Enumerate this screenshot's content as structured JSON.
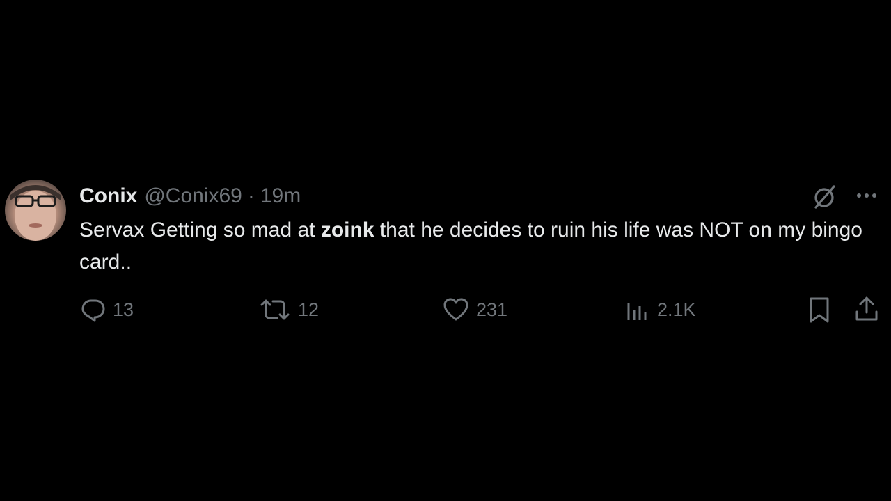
{
  "tweet": {
    "display_name": "Conix",
    "handle": "@Conix69",
    "separator": "·",
    "time": "19m",
    "text_before": "Servax Getting so mad at ",
    "text_bold": "zoink",
    "text_after": " that he decides to ruin his life was NOT on my bingo card..",
    "avatar_icon": "user-avatar"
  },
  "actions": {
    "reply_count": "13",
    "repost_count": "12",
    "like_count": "231",
    "views_count": "2.1K"
  },
  "icons": {
    "grok": "grok-icon",
    "more": "more-icon",
    "reply": "reply-icon",
    "repost": "repost-icon",
    "like": "heart-icon",
    "views": "views-icon",
    "bookmark": "bookmark-icon",
    "share": "share-icon"
  },
  "colors": {
    "background": "#000000",
    "primary_text": "#e7e9ea",
    "secondary_text": "#71767b"
  }
}
